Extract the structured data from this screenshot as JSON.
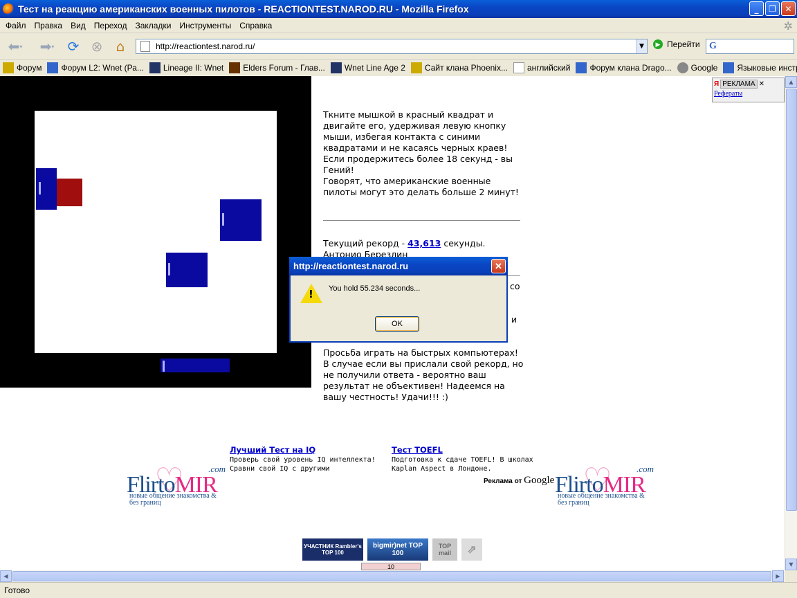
{
  "window": {
    "title": "Тест на реакцию американских военных пилотов - REACTIONTEST.NAROD.RU - Mozilla Firefox",
    "minimize": "_",
    "maximize": "❐",
    "close": "✕"
  },
  "menu": {
    "items": [
      "Файл",
      "Правка",
      "Вид",
      "Переход",
      "Закладки",
      "Инструменты",
      "Справка"
    ]
  },
  "toolbar": {
    "url": "http://reactiontest.narod.ru/",
    "go_label": "Перейти",
    "search_logo": "G"
  },
  "bookmarks": [
    {
      "label": "Форум",
      "color": "#ccaa00"
    },
    {
      "label": "Форум L2: Wnet (Ра...",
      "color": "#3366cc"
    },
    {
      "label": "Lineage II: Wnet",
      "color": "#223366"
    },
    {
      "label": "Elders Forum - Глав...",
      "color": "#663300"
    },
    {
      "label": "Wnet Line Age 2",
      "color": "#223366"
    },
    {
      "label": "Сайт клана Phoenix...",
      "color": "#ccaa00"
    },
    {
      "label": "английский",
      "color": "#999999"
    },
    {
      "label": "Форум клана Drago...",
      "color": "#3366cc"
    },
    {
      "label": "Google",
      "color": "#888888"
    },
    {
      "label": "Языковые инструм...",
      "color": "#3366cc"
    }
  ],
  "page": {
    "instructions": [
      "Ткните мышкой в красный квадрат и двигайте его, удерживая левую кнопку мыши, избегая контакта с синими квадратами и не касаясь черных краев!",
      "Если продержитесь более 18 секунд - вы Гений!",
      "Говорят, что американские военные пилоты могут это делать больше 2 минут!"
    ],
    "record_prefix": "Текущий рекорд - ",
    "record_value": "43,613",
    "record_suffix": " секунды.",
    "record_holder": "Антонио Березлин",
    "partial_right_1": "со",
    "partial_right_2": "и",
    "note": "Просьба играть на быстрых компьютерах! В случае если вы прислали свой рекорд, но не получили ответа - вероятно ваш результат не объективен! Надеемся на вашу честность! Удачи!!! :)",
    "ad1_title": "Лучший Тест на IQ",
    "ad1_line1": "Проверь свой уровень IQ интеллекта!",
    "ad1_line2": "Сравни свой IQ с другими",
    "ad2_title": "Тест TOEFL",
    "ad2_line1": "Подготовка к сдаче TOEFL! В школах",
    "ad2_line2": "Kaplan Aspect в Лондоне.",
    "google_ad_prefix": "Реклама от ",
    "google_ad_brand": "Google",
    "flirto_name_a": "Flirto",
    "flirto_name_b": "MIR",
    "flirto_com": ".com",
    "flirto_tag": "новые    общение знакомства & без границ",
    "yandex_label": "РЕКЛАМА",
    "yandex_link": "Рефераты",
    "counter_rambler": "УЧАСТНИК Rambler's TOP 100",
    "counter_bigmir": "bigmir)net TOP 100",
    "counter_mail": "TOP mail",
    "counter_small": "10"
  },
  "dialog": {
    "title": "http://reactiontest.narod.ru",
    "message": "You hold 55.234 seconds...",
    "ok": "OK"
  },
  "status": {
    "text": "Готово"
  },
  "colors": {
    "blue_block": "#0a0aa0",
    "red_block": "#a00e0e",
    "xp_title": "#0a46c4"
  }
}
